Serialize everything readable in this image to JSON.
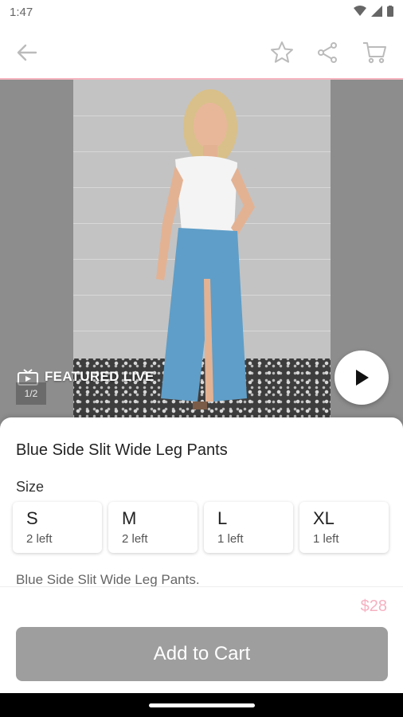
{
  "status_bar": {
    "time": "1:47",
    "icons": [
      "wifi-icon",
      "signal-icon",
      "battery-icon"
    ]
  },
  "top_bar": {
    "icons": [
      "back-arrow-icon",
      "star-icon",
      "share-icon",
      "cart-icon"
    ]
  },
  "media": {
    "featured_label": "FEATURED LIVE",
    "counter": "1/2"
  },
  "product": {
    "title": "Blue Side Slit Wide Leg Pants",
    "size_label": "Size",
    "sizes": [
      {
        "name": "S",
        "stock": "2 left"
      },
      {
        "name": "M",
        "stock": "2 left"
      },
      {
        "name": "L",
        "stock": "1 left"
      },
      {
        "name": "XL",
        "stock": "1 left"
      }
    ],
    "description": "Blue Side Slit Wide Leg Pants.",
    "price": "$28",
    "add_to_cart": "Add to Cart"
  },
  "colors": {
    "accent": "#f6b0c0",
    "button": "#9e9e9e"
  }
}
